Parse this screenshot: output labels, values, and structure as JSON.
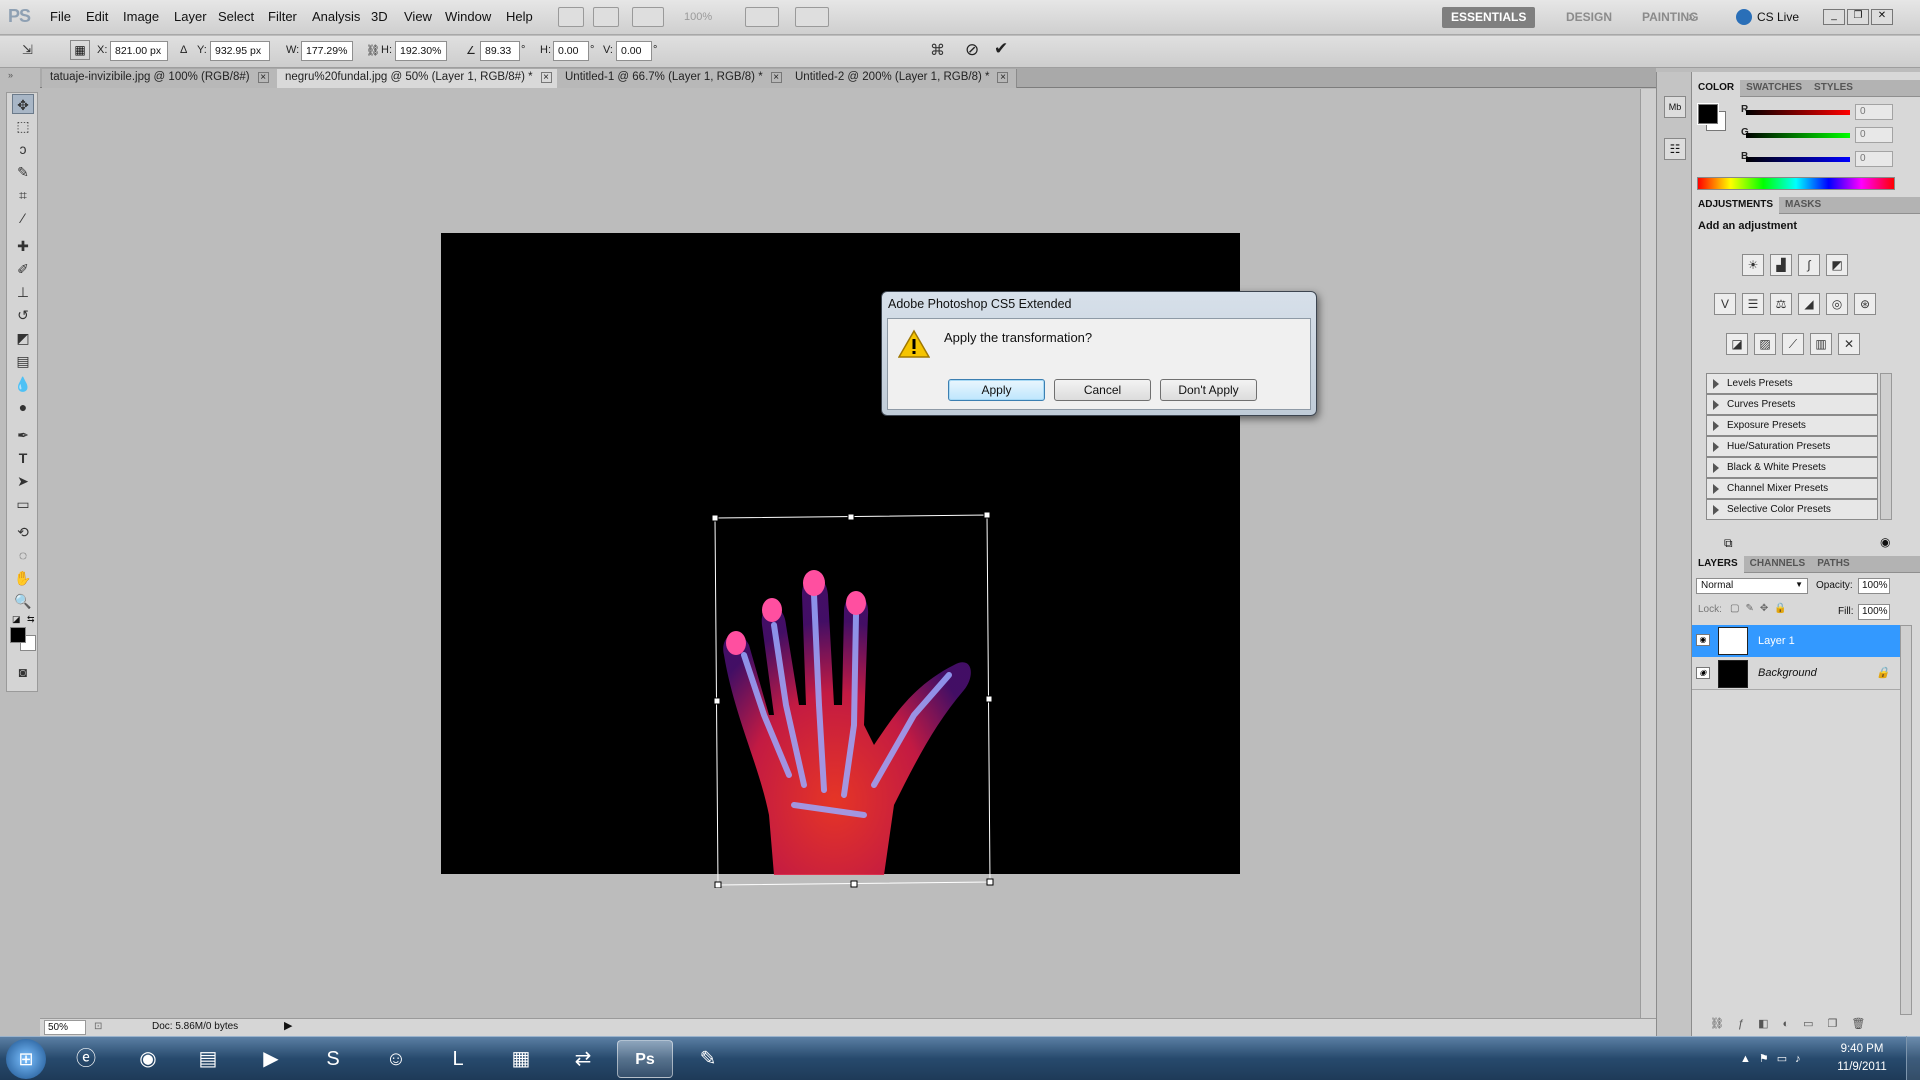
{
  "app": {
    "logo": "PS"
  },
  "menu": [
    "File",
    "Edit",
    "Image",
    "Layer",
    "Select",
    "Filter",
    "Analysis",
    "3D",
    "View",
    "Window",
    "Help"
  ],
  "menu_zoom": "100%",
  "workspaces": [
    "ESSENTIALS",
    "DESIGN",
    "PAINTING"
  ],
  "cslive": "CS Live",
  "options": {
    "x_label": "X:",
    "x": "821.00 px",
    "y_label": "Y:",
    "y": "932.95 px",
    "w_label": "W:",
    "w": "177.29%",
    "h_label": "H:",
    "h": "192.30%",
    "angle": "89.33",
    "hskew_label": "H:",
    "hskew": "0.00",
    "vskew_label": "V:",
    "vskew": "0.00",
    "deg": "°"
  },
  "tabs": [
    {
      "label": "tatuaje-invizibile.jpg @ 100% (RGB/8#)"
    },
    {
      "label": "negru%20fundal.jpg @ 50% (Layer 1, RGB/8#) *"
    },
    {
      "label": "Untitled-1 @ 66.7% (Layer 1, RGB/8) *"
    },
    {
      "label": "Untitled-2 @ 200% (Layer 1, RGB/8) *"
    }
  ],
  "dialog": {
    "title": "Adobe Photoshop CS5 Extended",
    "message": "Apply the transformation?",
    "apply": "Apply",
    "cancel": "Cancel",
    "dont_apply": "Don't Apply"
  },
  "status": {
    "zoom": "50%",
    "doc": "Doc: 5.86M/0 bytes"
  },
  "color_panel": {
    "tabs": [
      "COLOR",
      "SWATCHES",
      "STYLES"
    ],
    "r_label": "R",
    "g_label": "G",
    "b_label": "B",
    "r": "0",
    "g": "0",
    "b": "0"
  },
  "adjustments": {
    "tabs": [
      "ADJUSTMENTS",
      "MASKS"
    ],
    "heading": "Add an adjustment",
    "presets": [
      "Levels Presets",
      "Curves Presets",
      "Exposure Presets",
      "Hue/Saturation Presets",
      "Black & White Presets",
      "Channel Mixer Presets",
      "Selective Color Presets"
    ]
  },
  "layers_panel": {
    "tabs": [
      "LAYERS",
      "CHANNELS",
      "PATHS"
    ],
    "blend": "Normal",
    "opacity_label": "Opacity:",
    "opacity": "100%",
    "lock_label": "Lock:",
    "fill_label": "Fill:",
    "fill": "100%",
    "layers": [
      {
        "name": "Layer 1"
      },
      {
        "name": "Background"
      }
    ]
  },
  "clock": {
    "time": "9:40 PM",
    "date": "11/9/2011"
  },
  "colors": {
    "selected_layer": "#3399ff",
    "photo_bg": "#000000"
  }
}
